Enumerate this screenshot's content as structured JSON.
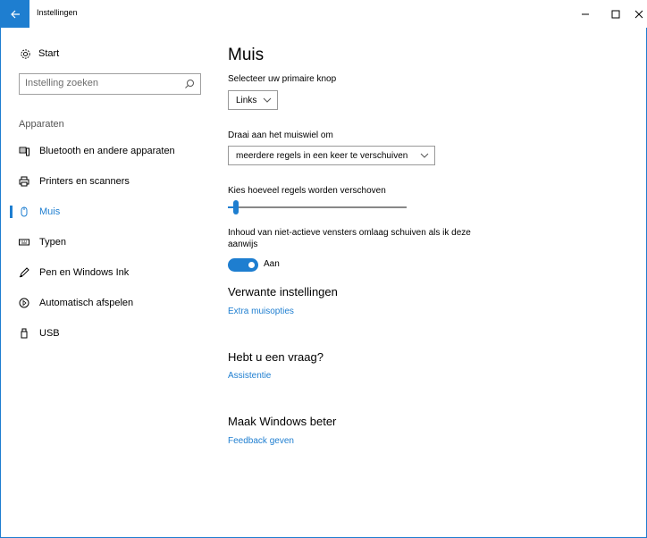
{
  "window": {
    "title": "Instellingen",
    "back_icon": "back-arrow-icon",
    "accent": "#1e7ed0"
  },
  "sidebar": {
    "start_label": "Start",
    "search_placeholder": "Instelling zoeken",
    "section_label": "Apparaten",
    "items": [
      {
        "label": "Bluetooth en andere apparaten",
        "icon": "bluetooth-devices-icon",
        "active": false
      },
      {
        "label": "Printers en scanners",
        "icon": "printer-icon",
        "active": false
      },
      {
        "label": "Muis",
        "icon": "mouse-icon",
        "active": true
      },
      {
        "label": "Typen",
        "icon": "keyboard-icon",
        "active": false
      },
      {
        "label": "Pen en Windows Ink",
        "icon": "pen-icon",
        "active": false
      },
      {
        "label": "Automatisch afspelen",
        "icon": "autoplay-icon",
        "active": false
      },
      {
        "label": "USB",
        "icon": "usb-icon",
        "active": false
      }
    ]
  },
  "main": {
    "title": "Muis",
    "primary_button": {
      "label": "Selecteer uw primaire knop",
      "value": "Links"
    },
    "wheel": {
      "label": "Draai aan het muiswiel om",
      "value": "meerdere regels in een keer te verschuiven"
    },
    "lines": {
      "label": "Kies hoeveel regels worden verschoven",
      "value_fraction": 0.03
    },
    "inactive_scroll": {
      "label": "Inhoud van niet-actieve vensters omlaag schuiven als ik deze aanwijs",
      "state": "Aan"
    },
    "related": {
      "heading": "Verwante instellingen",
      "link": "Extra muisopties"
    },
    "question": {
      "heading": "Hebt u een vraag?",
      "link": "Assistentie"
    },
    "improve": {
      "heading": "Maak Windows beter",
      "link": "Feedback geven"
    }
  }
}
